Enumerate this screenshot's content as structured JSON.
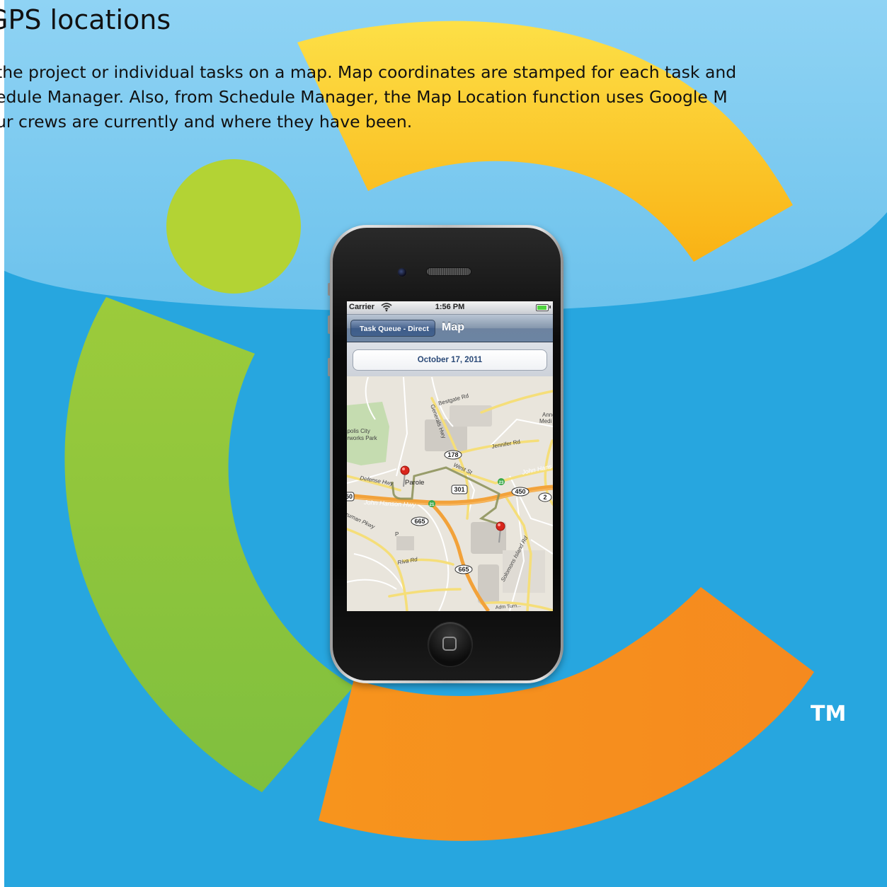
{
  "page": {
    "heading": "GPS locations",
    "description_lines": [
      "the project or individual tasks on a map.  Map coordinates are stamped for each task and",
      "edule Manager.  Also, from Schedule Manager, the Map Location function uses Google M",
      "ur crews are currently and where they have been."
    ],
    "trademark": "TM"
  },
  "phone": {
    "status_bar": {
      "carrier": "Carrier",
      "time": "1:56 PM"
    },
    "nav_bar": {
      "back_button": "Task Queue - Direct",
      "title": "Map"
    },
    "date_selector": {
      "label": "October 17, 2011"
    },
    "map": {
      "labels": {
        "bestgate": "Bestgate Rd",
        "generals": "Generals Hwy",
        "park1": "apolis City",
        "park2": "erworks Park",
        "jennifer": "Jennifer Rd",
        "defense": "Defense Hwy",
        "parole": "Parole",
        "west": "West St",
        "john_hanson_right": "John Hans",
        "john_hanson_left": "John Hanson Hwy",
        "truman": "ruman Pkwy",
        "riva": "Riva Rd",
        "solomons": "Solomons Island Rd",
        "anne1": "Anne",
        "anne2": "Medi",
        "p": "P",
        "admiral": "Adm Turn..."
      },
      "shields": {
        "r178": "178",
        "r301": "301",
        "r450": "450",
        "r2": "2",
        "r665a": "665",
        "r665b": "665",
        "r50": "50",
        "r21": "21",
        "r23": "23"
      }
    }
  },
  "colors": {
    "sky_blue": "#29a8e0",
    "light_blue": "#84cdf1",
    "yellow": "#fbbf14",
    "green": "#8dc63f",
    "orange": "#f7941d",
    "nav_blue": "#6d83a0"
  }
}
